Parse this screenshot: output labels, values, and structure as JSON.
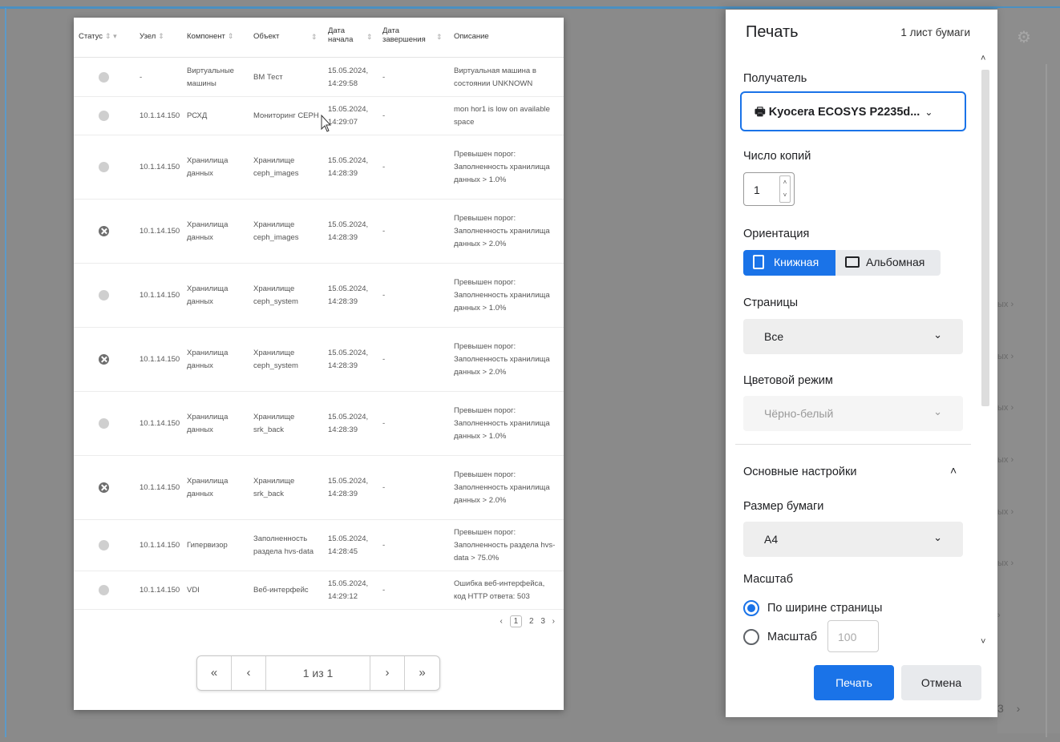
{
  "background": {
    "side_items": [
      "ых ›",
      "ых ›",
      "ых ›",
      "ых ›",
      "ых ›",
      "ых ›",
      "› "
    ],
    "pager": "3 ›"
  },
  "preview": {
    "headers": {
      "status": "Статус",
      "node": "Узел",
      "component": "Компонент",
      "object": "Объект",
      "start_date": "Дата начала",
      "end_date": "Дата завершения",
      "description": "Описание"
    },
    "rows": [
      {
        "status": "ok",
        "node": "-",
        "component": "Виртуальные машины",
        "object": "ВМ Тест",
        "start": "15.05.2024, 14:29:58",
        "end": "-",
        "description": "Виртуальная машина в состоянии UNKNOWN"
      },
      {
        "status": "ok",
        "node": "10.1.14.150",
        "component": "РСХД",
        "object": "Мониторинг СЕРН",
        "start": "15.05.2024, 14:29:07",
        "end": "-",
        "description": "mon hor1 is low on available space"
      },
      {
        "status": "ok",
        "node": "10.1.14.150",
        "component": "Хранилища данных",
        "object": "Хранилище ceph_images",
        "start": "15.05.2024, 14:28:39",
        "end": "-",
        "description": "Превышен порог: Заполненность хранилища данных > 1.0%"
      },
      {
        "status": "err",
        "node": "10.1.14.150",
        "component": "Хранилища данных",
        "object": "Хранилище ceph_images",
        "start": "15.05.2024, 14:28:39",
        "end": "-",
        "description": "Превышен порог: Заполненность хранилища данных > 2.0%"
      },
      {
        "status": "ok",
        "node": "10.1.14.150",
        "component": "Хранилища данных",
        "object": "Хранилище ceph_system",
        "start": "15.05.2024, 14:28:39",
        "end": "-",
        "description": "Превышен порог: Заполненность хранилища данных > 1.0%"
      },
      {
        "status": "err",
        "node": "10.1.14.150",
        "component": "Хранилища данных",
        "object": "Хранилище ceph_system",
        "start": "15.05.2024, 14:28:39",
        "end": "-",
        "description": "Превышен порог: Заполненность хранилища данных > 2.0%"
      },
      {
        "status": "ok",
        "node": "10.1.14.150",
        "component": "Хранилища данных",
        "object": "Хранилище srk_back",
        "start": "15.05.2024, 14:28:39",
        "end": "-",
        "description": "Превышен порог: Заполненность хранилища данных > 1.0%"
      },
      {
        "status": "err",
        "node": "10.1.14.150",
        "component": "Хранилища данных",
        "object": "Хранилище srk_back",
        "start": "15.05.2024, 14:28:39",
        "end": "-",
        "description": "Превышен порог: Заполненность хранилища данных > 2.0%"
      },
      {
        "status": "ok",
        "node": "10.1.14.150",
        "component": "Гипервизор",
        "object": "Заполненность раздела hvs-data",
        "start": "15.05.2024, 14:28:45",
        "end": "-",
        "description": "Превышен порог: Заполненность раздела hvs-data > 75.0%"
      },
      {
        "status": "ok",
        "node": "10.1.14.150",
        "component": "VDI",
        "object": "Веб-интерфейс",
        "start": "15.05.2024, 14:29:12",
        "end": "-",
        "description": "Ошибка веб-интерфейса, код HTTP ответа: 503"
      }
    ],
    "mini_pager": {
      "prev": "‹",
      "pages": [
        "1",
        "2",
        "3"
      ],
      "next": "›"
    },
    "pager": {
      "first": "«",
      "prev": "‹",
      "label": "1 из 1",
      "next": "›",
      "last": "»"
    }
  },
  "dialog": {
    "title": "Печать",
    "sheets": "1 лист бумаги",
    "destination_label": "Получатель",
    "destination_value": "Kyocera ECOSYS P2235d...",
    "copies_label": "Число копий",
    "copies_value": "1",
    "orientation_label": "Ориентация",
    "orientation_portrait": "Книжная",
    "orientation_landscape": "Альбомная",
    "pages_label": "Страницы",
    "pages_value": "Все",
    "color_label": "Цветовой режим",
    "color_value": "Чёрно-белый",
    "basic_settings": "Основные настройки",
    "paper_label": "Размер бумаги",
    "paper_value": "A4",
    "scale_label": "Масштаб",
    "scale_fit": "По ширине страницы",
    "scale_custom": "Масштаб",
    "scale_value": "100",
    "print_button": "Печать",
    "cancel_button": "Отмена"
  },
  "colors": {
    "accent": "#1a73e8"
  }
}
